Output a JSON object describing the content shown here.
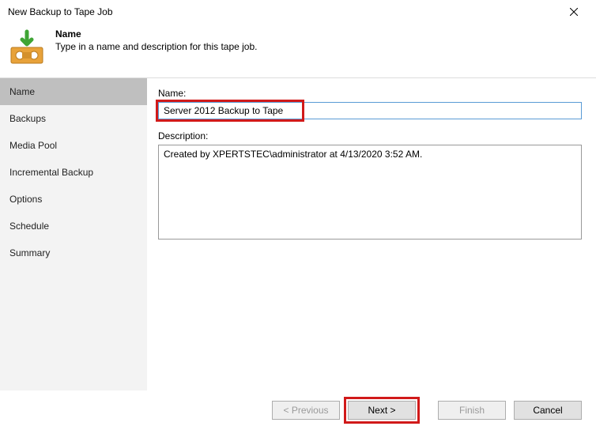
{
  "window": {
    "title": "New Backup to Tape Job"
  },
  "header": {
    "title": "Name",
    "subtitle": "Type in a name and description for this tape job."
  },
  "sidebar": {
    "items": [
      {
        "label": "Name",
        "active": true
      },
      {
        "label": "Backups",
        "active": false
      },
      {
        "label": "Media Pool",
        "active": false
      },
      {
        "label": "Incremental Backup",
        "active": false
      },
      {
        "label": "Options",
        "active": false
      },
      {
        "label": "Schedule",
        "active": false
      },
      {
        "label": "Summary",
        "active": false
      }
    ]
  },
  "form": {
    "name_label": "Name:",
    "name_value": "Server 2012 Backup to Tape",
    "description_label": "Description:",
    "description_value": "Created by XPERTSTEC\\administrator at 4/13/2020 3:52 AM."
  },
  "footer": {
    "previous": "< Previous",
    "next": "Next >",
    "finish": "Finish",
    "cancel": "Cancel"
  }
}
